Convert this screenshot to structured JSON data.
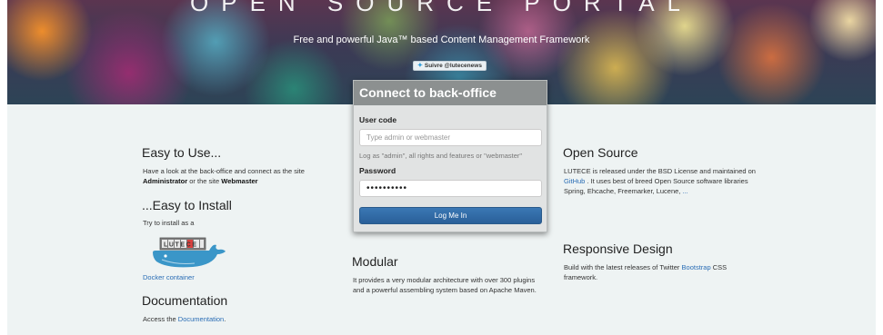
{
  "hero": {
    "title": "OPEN SOURCE PORTAL",
    "subtitle": "Free and powerful Java™ based Content Management Framework",
    "follow_label": "Suivre @lutecenews",
    "follow_icon": "twitter-bird-icon"
  },
  "login": {
    "title": "Connect to back-office",
    "user_code_label": "User code",
    "user_code_placeholder": "Type admin or webmaster",
    "help_text": "Log as \"admin\", all rights and features or \"webmaster\"",
    "password_label": "Password",
    "password_value": "••••••••••",
    "submit_label": "Log Me In"
  },
  "easy_use": {
    "title": "Easy to Use...",
    "text_before": "Have a look at the back-office and connect as the site ",
    "admin": "Administrator",
    "text_middle": " or the site ",
    "webmaster": "Webmaster"
  },
  "easy_install": {
    "title": "...Easy to Install",
    "text": "Try to install as a",
    "logo_text": "LUTECE",
    "docker_link": "Docker container"
  },
  "documentation": {
    "title": "Documentation",
    "text": "Access the ",
    "link": "Documentation",
    "suffix": "."
  },
  "modular": {
    "title": "Modular",
    "text": "It provides a very modular architecture with over 300 plugins and a powerful assembling system based on Apache Maven."
  },
  "open_source": {
    "title": "Open Source",
    "text_1": "LUTECE is released under the BSD License and maintained on ",
    "github_link": "GitHub",
    "text_2": " . It uses best of breed Open Source software libraries Spring, Ehcache, Freemarker, Lucene, ",
    "more_link": "..."
  },
  "responsive": {
    "title": "Responsive Design",
    "text_1": "Build with the latest releases of Twitter ",
    "bootstrap_link": "Bootstrap",
    "text_2": " CSS framework."
  },
  "colors": {
    "accent": "#2a6db5",
    "button": "#2a5f99",
    "panel_header": "#8c9090",
    "background": "#eef3f3",
    "whale": "#3a96c8"
  }
}
